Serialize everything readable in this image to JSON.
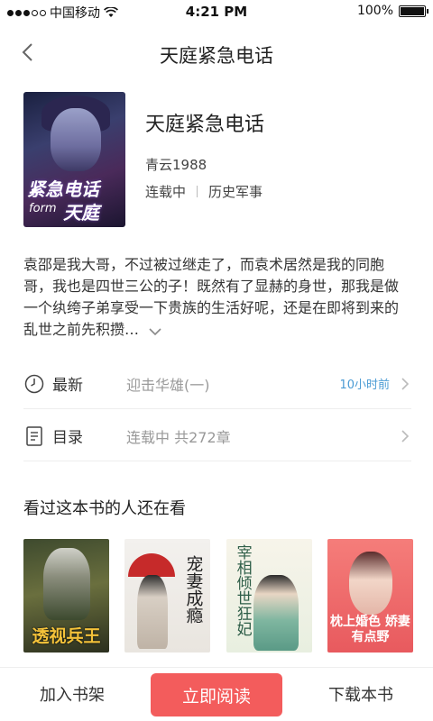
{
  "status_bar": {
    "carrier": "中国移动",
    "time": "4:21 PM",
    "battery": "100%",
    "battery_level": 1.0
  },
  "nav": {
    "title": "天庭紧急电话"
  },
  "book": {
    "title": "天庭紧急电话",
    "author": "青云1988",
    "status": "连载中",
    "genre": "历史军事",
    "cover_text_main": "紧急电话",
    "cover_text_sub": "form",
    "cover_text_tail": "天庭"
  },
  "synopsis": {
    "text": "袁邵是我大哥，不过被过继走了，而袁术居然是我的同胞哥，我也是四世三公的子！既然有了显赫的身世，那我是做一个纨绔子弟享受一下贵族的生活好呢，还是在即将到来的乱世之前先积攒…"
  },
  "latest": {
    "label": "最新",
    "chapter": "迎击华雄(一)",
    "time": "10小时前"
  },
  "toc": {
    "label": "目录",
    "value": "连载中 共272章"
  },
  "recommend": {
    "heading": "看过这本书的人还在看",
    "books": [
      {
        "cover_text": "透视兵王"
      },
      {
        "cover_text": "宠妻成瘾"
      },
      {
        "cover_text": "宰相倾世狂妃"
      },
      {
        "cover_text": "枕上婚色 娇妻有点野"
      }
    ]
  },
  "bottom_bar": {
    "shelf_label": "加入书架",
    "read_label": "立即阅读",
    "download_label": "下载本书"
  },
  "colors": {
    "accent": "#f35c5c",
    "time_blue": "#4a9bd4"
  },
  "icons": {
    "back": "chevron-left-icon",
    "clock": "clock-icon",
    "toc": "document-list-icon",
    "chevron": "chevron-right-icon",
    "expand": "chevron-down-icon",
    "wifi": "wifi-icon"
  }
}
